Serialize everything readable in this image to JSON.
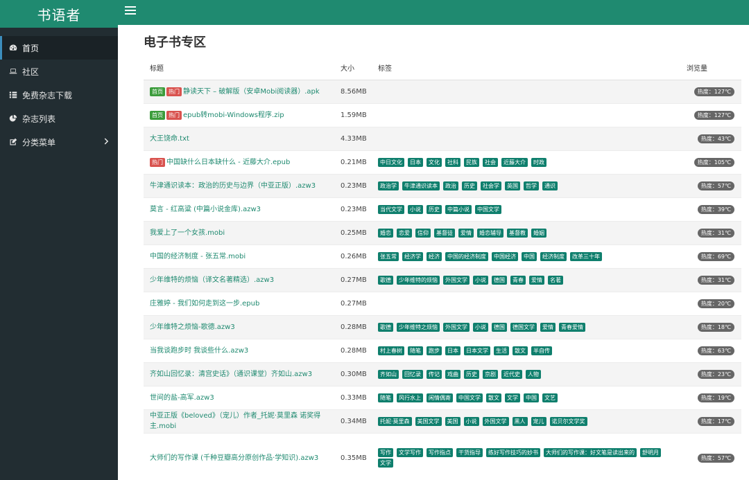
{
  "sidebar": {
    "brand": "书语者",
    "items": [
      {
        "label": "首页"
      },
      {
        "label": "社区"
      },
      {
        "label": "免费杂志下载"
      },
      {
        "label": "杂志列表"
      },
      {
        "label": "分类菜单"
      }
    ]
  },
  "main": {
    "title": "电子书专区",
    "columns": {
      "title": "标题",
      "size": "大小",
      "tags": "标签",
      "views": "浏览量"
    },
    "rows": [
      {
        "badges": [
          "首页",
          "热门"
        ],
        "title": "静读天下 – 破解版（安卓Mobi阅读器）.apk",
        "size": "8.56MB",
        "tags": [],
        "heat": "热度：127℃"
      },
      {
        "badges": [
          "首页",
          "热门"
        ],
        "title": "epub转mobi-Windows程序.zip",
        "size": "1.59MB",
        "tags": [],
        "heat": "热度：127℃"
      },
      {
        "badges": [],
        "title": "大王饶命.txt",
        "size": "4.33MB",
        "tags": [],
        "heat": "热度：43℃"
      },
      {
        "badges": [
          "热门"
        ],
        "title": "中国缺什么日本缺什么 - 近藤大介.epub",
        "size": "0.21MB",
        "tags": [
          "中日文化",
          "日本",
          "文化",
          "社科",
          "民族",
          "社会",
          "近藤大介",
          "时政"
        ],
        "heat": "热度：105℃"
      },
      {
        "badges": [],
        "title": "牛津通识读本：政治的历史与边界（中亚正版）.azw3",
        "size": "0.23MB",
        "tags": [
          "政治学",
          "牛津通识读本",
          "政治",
          "历史",
          "社会学",
          "英国",
          "哲学",
          "通识"
        ],
        "heat": "热度：57℃"
      },
      {
        "badges": [],
        "title": "莫言 - 红高粱 (中篇小说金库).azw3",
        "size": "0.23MB",
        "tags": [
          "当代文学",
          "小说",
          "历史",
          "中篇小说",
          "中国文学"
        ],
        "heat": "热度：39℃"
      },
      {
        "badges": [],
        "title": "我爱上了一个女孩.mobi",
        "size": "0.25MB",
        "tags": [
          "婚恋",
          "恋爱",
          "信仰",
          "基督徒",
          "爱情",
          "婚恋辅导",
          "基督教",
          "婚姻"
        ],
        "heat": "热度：31℃"
      },
      {
        "badges": [],
        "title": "中国的经济制度 - 张五常.mobi",
        "size": "0.26MB",
        "tags": [
          "张五常",
          "经济学",
          "经济",
          "中国的经济制度",
          "中国经济",
          "中国",
          "经济制度",
          "改革三十年"
        ],
        "heat": "热度：69℃"
      },
      {
        "badges": [],
        "title": "少年维特的烦恼（译文名著精选）.azw3",
        "size": "0.27MB",
        "tags": [
          "歌德",
          "少年维特的烦恼",
          "外国文学",
          "小说",
          "德国",
          "青春",
          "爱情",
          "名著"
        ],
        "heat": "热度：31℃"
      },
      {
        "badges": [],
        "title": "庄雅婷 - 我们如何走到这一步.epub",
        "size": "0.27MB",
        "tags": [],
        "heat": "热度：20℃"
      },
      {
        "badges": [],
        "title": "少年维特之烦恼-歌德.azw3",
        "size": "0.28MB",
        "tags": [
          "歌德",
          "少年维特之烦恼",
          "外国文学",
          "小说",
          "德国",
          "德国文学",
          "爱情",
          "青春爱情"
        ],
        "heat": "热度：18℃"
      },
      {
        "badges": [],
        "title": "当我谈跑步时 我谈些什么.azw3",
        "size": "0.28MB",
        "tags": [
          "村上春树",
          "随笔",
          "跑步",
          "日本",
          "日本文学",
          "生活",
          "散文",
          "半自传"
        ],
        "heat": "热度：63℃"
      },
      {
        "badges": [],
        "title": "齐如山回忆录：清宫史话》（通识课堂）齐如山.azw3",
        "size": "0.30MB",
        "tags": [
          "齐如山",
          "回忆录",
          "传记",
          "戏曲",
          "历史",
          "京剧",
          "近代史",
          "人物"
        ],
        "heat": "热度：23℃"
      },
      {
        "badges": [],
        "title": "世间的盐-高军.azw3",
        "size": "0.33MB",
        "tags": [
          "随笔",
          "风行水上",
          "闲情偶寄",
          "中国文学",
          "散文",
          "文学",
          "中国",
          "文艺"
        ],
        "heat": "热度：19℃"
      },
      {
        "badges": [],
        "title": "中亚正版《beloved》（宠儿）作者_托妮·莫里森 诺奖得主.mobi",
        "size": "0.34MB",
        "tags": [
          "托妮·莫里森",
          "美国文学",
          "美国",
          "小说",
          "外国文学",
          "黑人",
          "宠儿",
          "诺贝尔文学奖"
        ],
        "heat": "热度：17℃"
      },
      {
        "badges": [],
        "title": "大师们的写作课 (千种豆瓣高分原创作品·学知识).azw3",
        "size": "0.35MB",
        "tags": [
          "写作",
          "文学写作",
          "写作指点",
          "干货指导",
          "练好写作技巧的妙书",
          "大师们的写作课：好文笔是读出来的",
          "舒明月",
          "文学"
        ],
        "heat": "热度：57℃"
      }
    ]
  }
}
